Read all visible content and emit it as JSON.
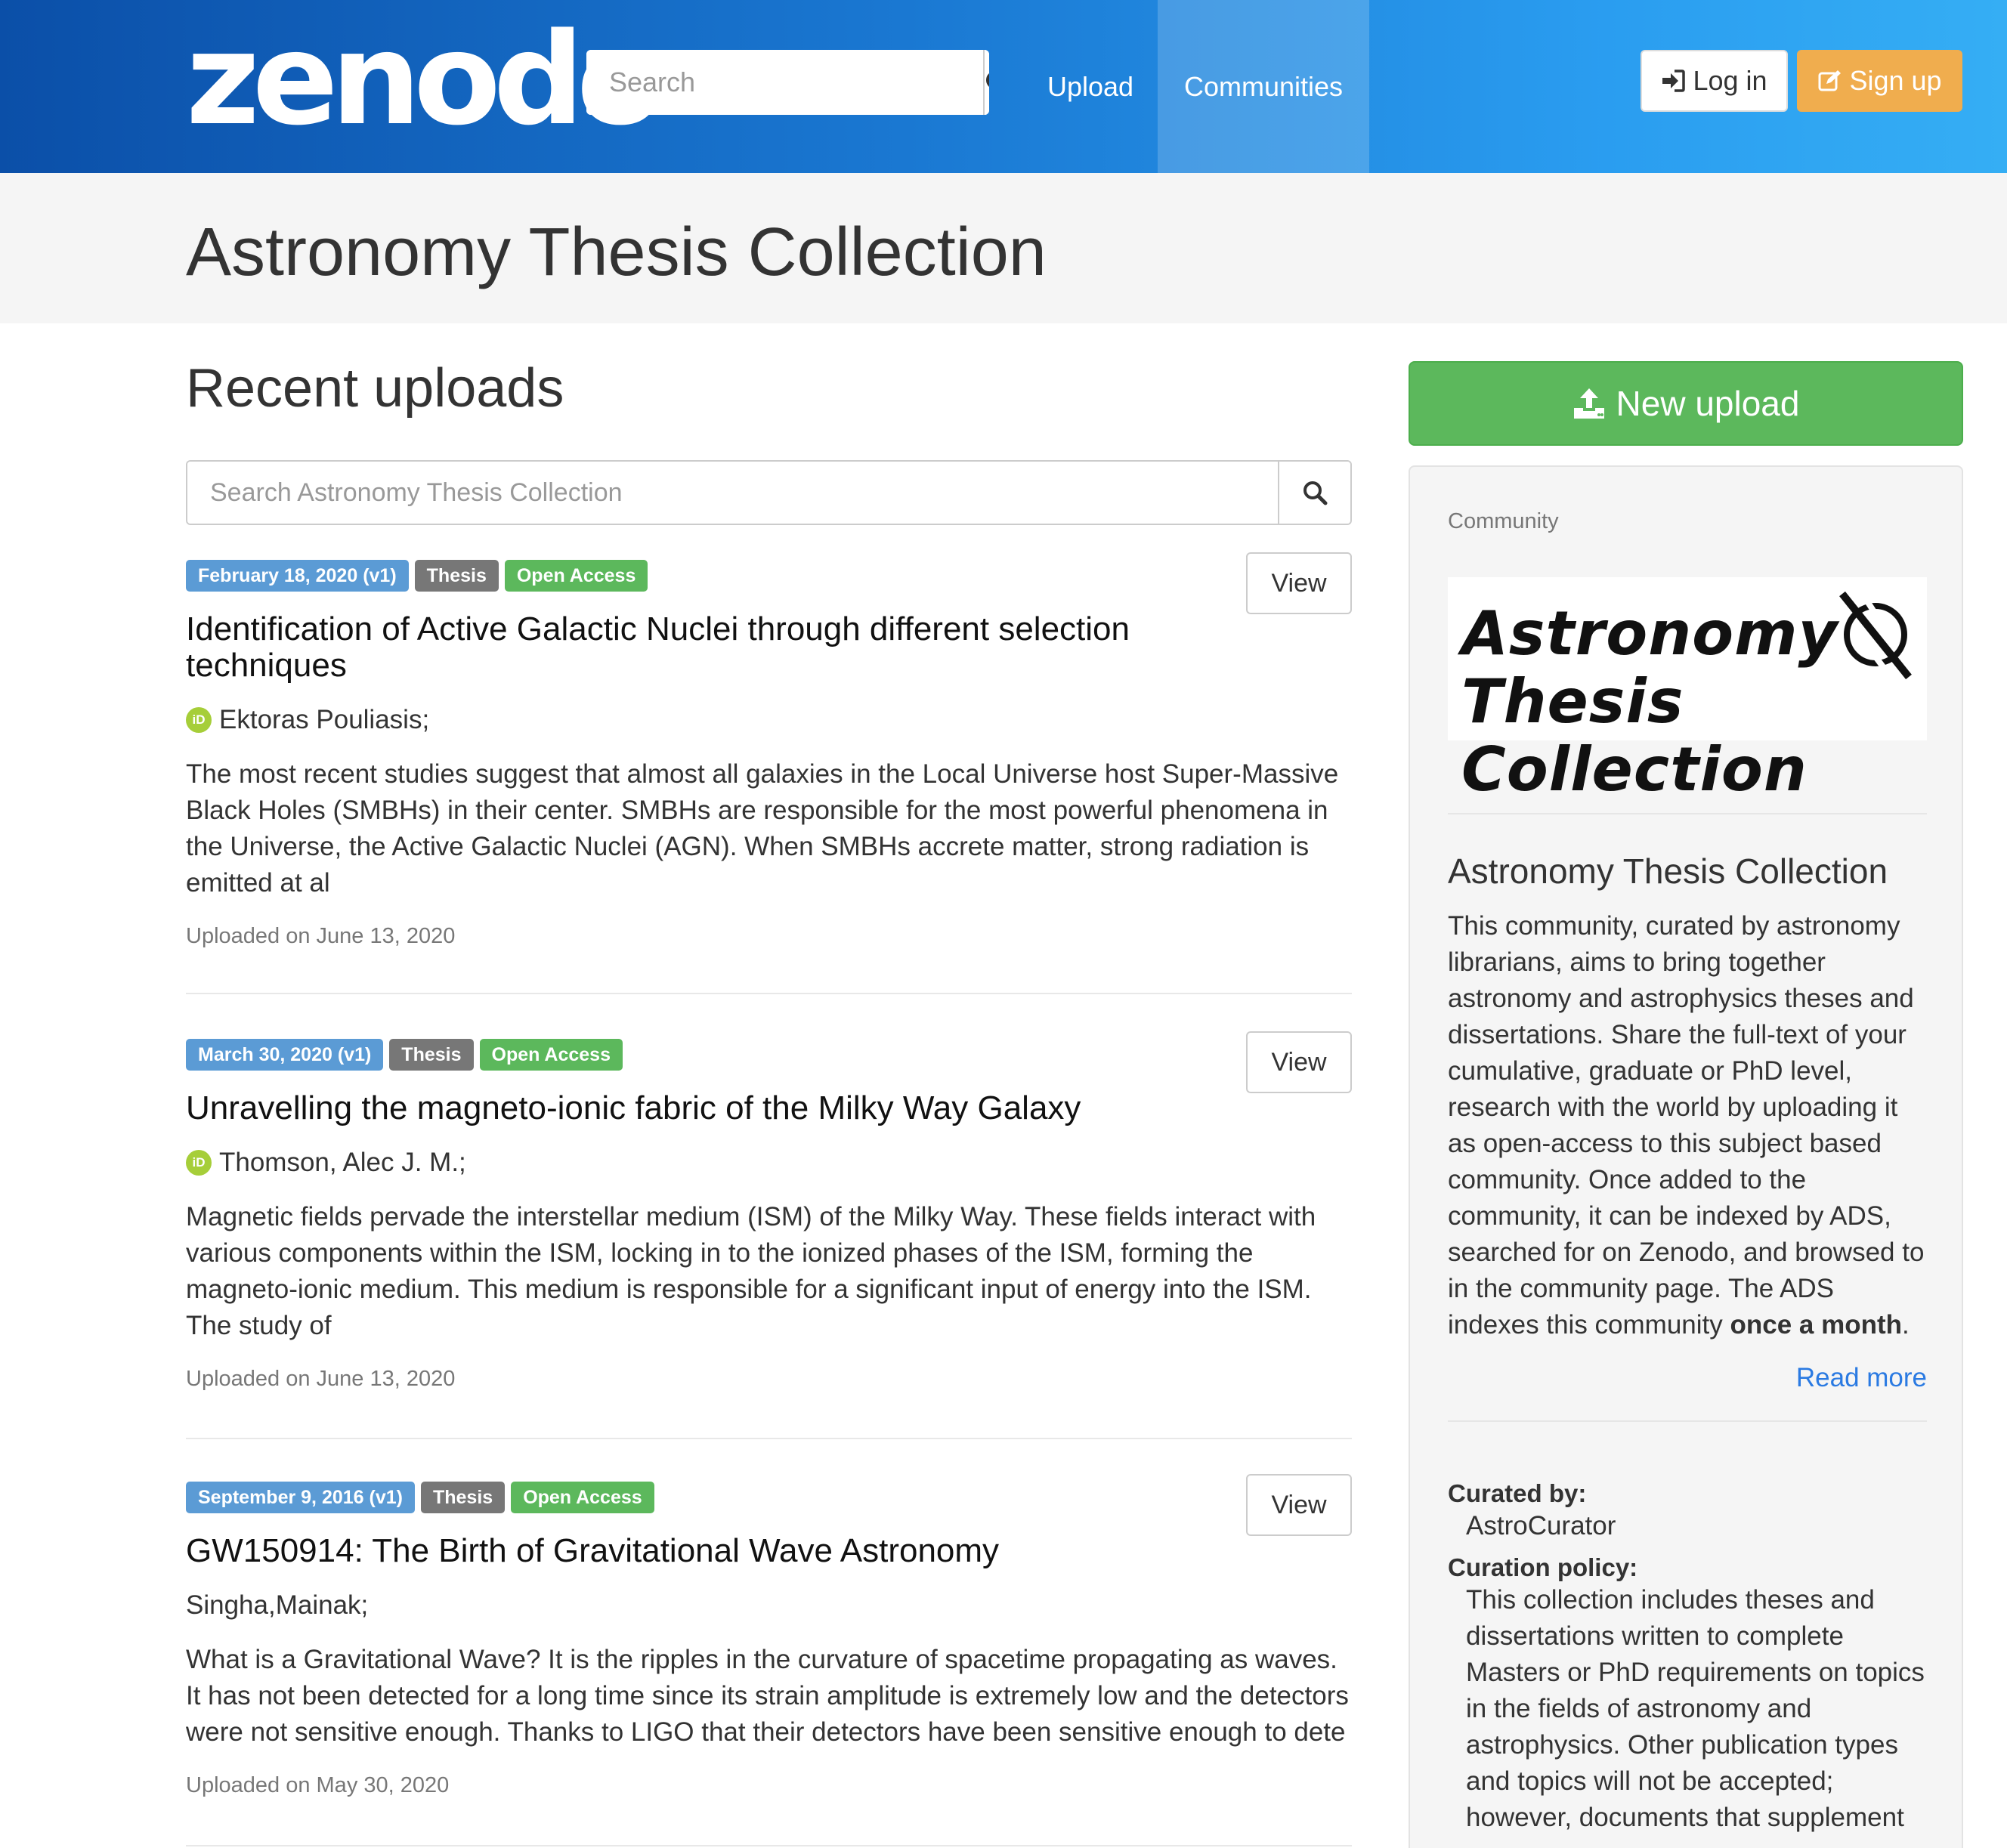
{
  "nav": {
    "logo": "zenodo",
    "search_placeholder": "Search",
    "upload": "Upload",
    "communities": "Communities",
    "login": "Log in",
    "signup": "Sign up"
  },
  "page": {
    "title": "Astronomy Thesis Collection"
  },
  "main": {
    "section_title": "Recent uploads",
    "search_placeholder": "Search Astronomy Thesis Collection",
    "view_label": "View",
    "records": [
      {
        "date_badge": "February 18, 2020 (v1)",
        "type_badge": "Thesis",
        "access_badge": "Open Access",
        "title": "Identification of Active Galactic Nuclei through different selection techniques",
        "authors": "Ektoras Pouliasis;",
        "orcid": true,
        "description": "The most recent studies suggest that almost all galaxies in the Local Universe host Super-Massive Black Holes (SMBHs) in their center. SMBHs are responsible for the most powerful phenomena in the Universe, the Active Galactic Nuclei (AGN). When SMBHs accrete matter, strong radiation is emitted at al",
        "uploaded": "Uploaded on June 13, 2020"
      },
      {
        "date_badge": "March 30, 2020 (v1)",
        "type_badge": "Thesis",
        "access_badge": "Open Access",
        "title": "Unravelling the magneto-ionic fabric of the Milky Way Galaxy",
        "authors": "Thomson, Alec J. M.;",
        "orcid": true,
        "description": "Magnetic fields pervade the interstellar medium (ISM) of the Milky Way. These fields interact with various components within the ISM, locking in to the ionized phases of the ISM, forming the magneto-ionic medium. This medium is responsible for a significant input of energy into the ISM. The study of",
        "uploaded": "Uploaded on June 13, 2020"
      },
      {
        "date_badge": "September 9, 2016 (v1)",
        "type_badge": "Thesis",
        "access_badge": "Open Access",
        "title": "GW150914: The Birth of Gravitational Wave Astronomy",
        "authors": "Singha,Mainak;",
        "orcid": false,
        "description": "What is a Gravitational Wave? It is the ripples in the curvature of spacetime propagating as waves. It has not been detected for a long time since its strain amplitude is extremely low and the detectors were not sensitive enough. Thanks to LIGO that their detectors have been sensitive enough to dete",
        "uploaded": "Uploaded on May 30, 2020"
      }
    ]
  },
  "sidebar": {
    "new_upload": "New upload",
    "community_label": "Community",
    "logo_line1": "Astronomy",
    "logo_line2": "Thesis Collection",
    "community_title": "Astronomy Thesis Collection",
    "description_main": "This community, curated by astronomy librarians, aims to bring together astronomy and astrophysics theses and dissertations.  Share the full-text of your cumulative, graduate or PhD level, research with the world by uploading it as open-access to this subject based community.  Once added to the community, it can be indexed by ADS, searched for on Zenodo, and browsed to in the community page. The ADS indexes this community ",
    "description_bold": "once a month",
    "description_end": ".",
    "read_more": "Read more",
    "curated_by_label": "Curated by:",
    "curated_by_value": "AstroCurator",
    "curation_policy_label": "Curation policy:",
    "curation_policy_value": "This collection includes theses and dissertations written to complete Masters or PhD requirements on topics in the fields of astronomy and astrophysics. Other publication types and topics will not be accepted; however, documents that supplement"
  },
  "colors": {
    "navbar_start": "#0b4fa8",
    "navbar_end": "#35aef4",
    "signup": "#f0ad4e",
    "new_upload": "#5cb85c",
    "badge_date": "#5b9bd5",
    "badge_type": "#777777",
    "badge_access": "#5cb85c",
    "link": "#2a7ae2"
  }
}
